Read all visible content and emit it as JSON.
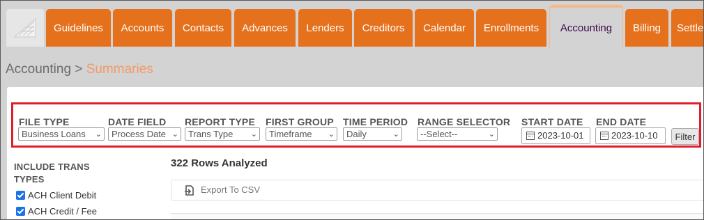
{
  "nav": {
    "tabs": [
      {
        "label": "Guidelines",
        "active": false
      },
      {
        "label": "Accounts",
        "active": false
      },
      {
        "label": "Contacts",
        "active": false
      },
      {
        "label": "Advances",
        "active": false
      },
      {
        "label": "Lenders",
        "active": false
      },
      {
        "label": "Creditors",
        "active": false
      },
      {
        "label": "Calendar",
        "active": false
      },
      {
        "label": "Enrollments",
        "active": false
      },
      {
        "label": "Accounting",
        "active": true
      },
      {
        "label": "Billing",
        "active": false
      },
      {
        "label": "Settle",
        "active": false
      }
    ]
  },
  "breadcrumb": {
    "section": "Accounting",
    "separator": ">",
    "current": "Summaries"
  },
  "filters": {
    "file_type": {
      "label": "FILE TYPE",
      "value": "Business Loans"
    },
    "date_field": {
      "label": "DATE FIELD",
      "value": "Process Date"
    },
    "report_type": {
      "label": "REPORT TYPE",
      "value": "Trans Type"
    },
    "first_group": {
      "label": "FIRST GROUP",
      "value": "Timeframe"
    },
    "time_period": {
      "label": "TIME PERIOD",
      "value": "Daily"
    },
    "range_selector": {
      "label": "RANGE SELECTOR",
      "value": "--Select--"
    },
    "start_date": {
      "label": "START DATE",
      "value": "2023-10-01"
    },
    "end_date": {
      "label": "END DATE",
      "value": "2023-10-10"
    },
    "filter_button": "Filter"
  },
  "sidebar": {
    "title": "INCLUDE TRANS TYPES",
    "items": [
      {
        "label": "ACH Client Debit",
        "checked": true
      },
      {
        "label": "ACH Credit / Fee",
        "checked": true
      }
    ]
  },
  "results": {
    "rows_text": "322 Rows Analyzed",
    "export_label": "Export To CSV"
  },
  "colors": {
    "tab_orange": "#e5711d",
    "highlight_red": "#e11d2b",
    "breadcrumb_current": "#f39a63"
  }
}
